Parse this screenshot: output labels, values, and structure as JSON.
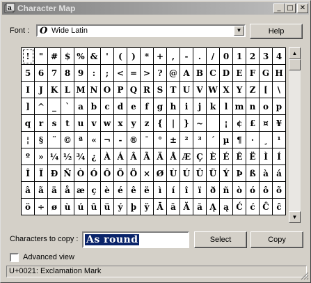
{
  "window": {
    "title": "Character Map"
  },
  "titlebar_buttons": {
    "minimize": "_",
    "maximize": "□",
    "close": "✕"
  },
  "font_row": {
    "label": "Font :",
    "value": "Wide Latin",
    "help_label": "Help"
  },
  "grid": {
    "rows": [
      [
        "!",
        "\"",
        "#",
        "$",
        "%",
        "&",
        "'",
        "(",
        ")",
        "*",
        "+",
        ",",
        "-",
        ".",
        "/",
        "0",
        "1",
        "2",
        "3",
        "4"
      ],
      [
        "5",
        "6",
        "7",
        "8",
        "9",
        ":",
        ";",
        "<",
        "=",
        ">",
        "?",
        "@",
        "A",
        "B",
        "C",
        "D",
        "E",
        "F",
        "G",
        "H"
      ],
      [
        "I",
        "J",
        "K",
        "L",
        "M",
        "N",
        "O",
        "P",
        "Q",
        "R",
        "S",
        "T",
        "U",
        "V",
        "W",
        "X",
        "Y",
        "Z",
        "[",
        "\\"
      ],
      [
        "]",
        "^",
        "_",
        "`",
        "a",
        "b",
        "c",
        "d",
        "e",
        "f",
        "g",
        "h",
        "i",
        "j",
        "k",
        "l",
        "m",
        "n",
        "o",
        "p"
      ],
      [
        "q",
        "r",
        "s",
        "t",
        "u",
        "v",
        "w",
        "x",
        "y",
        "z",
        "{",
        "|",
        "}",
        "~",
        " ",
        "¡",
        "¢",
        "£",
        "¤",
        "¥"
      ],
      [
        "¦",
        "§",
        "¨",
        "©",
        "ª",
        "«",
        "¬",
        "-",
        "®",
        "¯",
        "°",
        "±",
        "²",
        "³",
        "´",
        "µ",
        "¶",
        "·",
        "¸",
        "¹"
      ],
      [
        "º",
        "»",
        "¼",
        "½",
        "¾",
        "¿",
        "À",
        "Á",
        "Â",
        "Ã",
        "Ä",
        "Å",
        "Æ",
        "Ç",
        "È",
        "É",
        "Ê",
        "Ë",
        "Ì",
        "Í"
      ],
      [
        "Î",
        "Ï",
        "Ð",
        "Ñ",
        "Ò",
        "Ó",
        "Ô",
        "Õ",
        "Ö",
        "×",
        "Ø",
        "Ù",
        "Ú",
        "Û",
        "Ü",
        "Ý",
        "Þ",
        "ß",
        "à",
        "á"
      ],
      [
        "â",
        "ã",
        "ä",
        "å",
        "æ",
        "ç",
        "è",
        "é",
        "ê",
        "ë",
        "ì",
        "í",
        "î",
        "ï",
        "ð",
        "ñ",
        "ò",
        "ó",
        "ô",
        "õ"
      ],
      [
        "ö",
        "÷",
        "ø",
        "ù",
        "ú",
        "û",
        "ü",
        "ý",
        "þ",
        "ÿ",
        "Ā",
        "ā",
        "Ă",
        "ă",
        "Ą",
        "ą",
        "Ć",
        "ć",
        "Ĉ",
        "ĉ"
      ]
    ]
  },
  "copy_row": {
    "label": "Characters to copy :",
    "value": "As round",
    "select_label": "Select",
    "copy_label": "Copy"
  },
  "advanced": {
    "label": "Advanced view",
    "checked": false
  },
  "status_bar": {
    "text": "U+0021: Exclamation Mark"
  }
}
